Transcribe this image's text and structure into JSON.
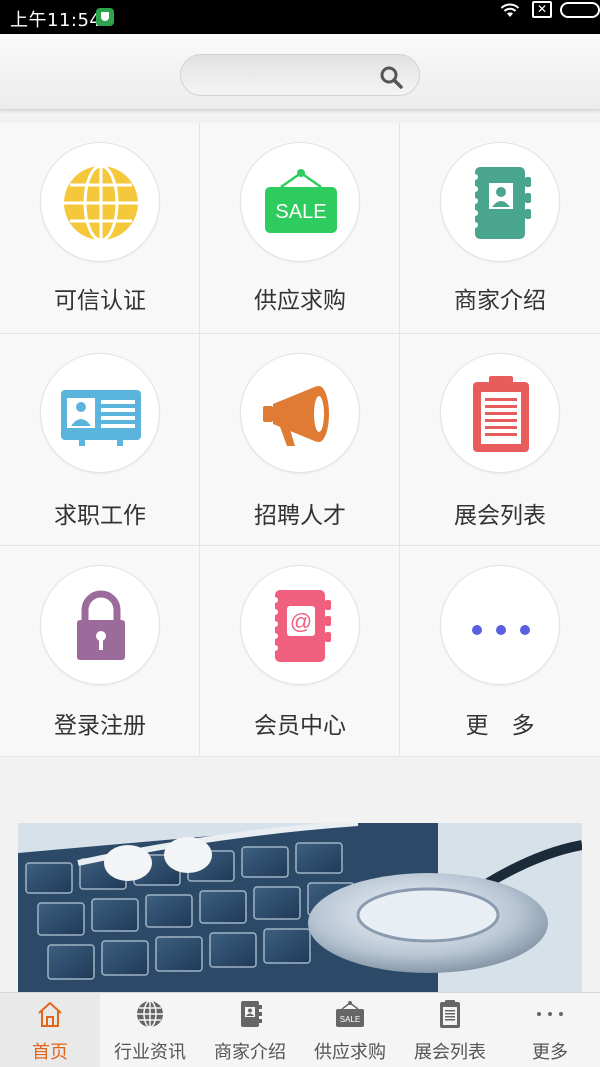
{
  "status_bar": {
    "time": "上午11:54",
    "notification": "✕"
  },
  "search": {
    "placeholder": ""
  },
  "grid": [
    {
      "label": "可信认证",
      "icon": "globe-icon"
    },
    {
      "label": "供应求购",
      "icon": "sale-sign-icon",
      "icon_text": "SALE"
    },
    {
      "label": "商家介绍",
      "icon": "address-book-icon"
    },
    {
      "label": "求职工作",
      "icon": "id-card-icon"
    },
    {
      "label": "招聘人才",
      "icon": "megaphone-icon"
    },
    {
      "label": "展会列表",
      "icon": "clipboard-icon"
    },
    {
      "label": "登录注册",
      "icon": "lock-icon"
    },
    {
      "label": "会员中心",
      "icon": "contact-book-icon",
      "icon_text": "@"
    },
    {
      "label": "更　多",
      "icon": "more-dots-icon"
    }
  ],
  "banner": {
    "image": "stethoscope-on-keyboard"
  },
  "tabbar": [
    {
      "label": "首页",
      "icon": "home-icon",
      "active": true
    },
    {
      "label": "行业资讯",
      "icon": "globe-icon"
    },
    {
      "label": "商家介绍",
      "icon": "address-book-icon"
    },
    {
      "label": "供应求购",
      "icon": "sale-sign-icon",
      "icon_text": "SALE"
    },
    {
      "label": "展会列表",
      "icon": "clipboard-icon"
    },
    {
      "label": "更多",
      "icon": "more-dots-icon"
    }
  ],
  "colors": {
    "accent": "#e0661c",
    "globe": "#f5c83c",
    "sale": "#2ecc5e",
    "book": "#4aa58f",
    "idcard": "#5ab4dc",
    "megaphone": "#e07b33",
    "clipboard": "#e85c5c",
    "lock": "#9b6b9b",
    "contact": "#f0607e",
    "dots": "#5a5fe0"
  }
}
